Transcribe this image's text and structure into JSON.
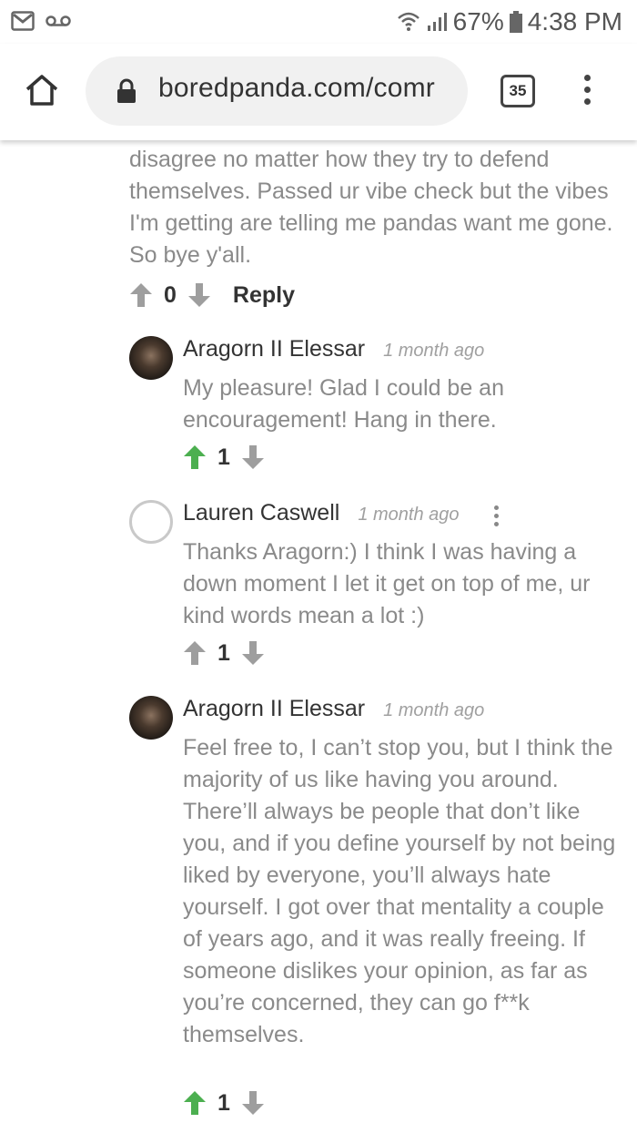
{
  "status": {
    "battery": "67%",
    "time": "4:38 PM"
  },
  "browser": {
    "url": "boredpanda.com/comr",
    "tab_count": "35"
  },
  "top_comment": {
    "text": "disagree no matter how they try to defend themselves. Passed ur vibe check but the vibes I'm getting are telling me pandas want me gone. So bye y'all.",
    "votes": "0",
    "reply_label": "Reply"
  },
  "replies": [
    {
      "author": "Aragorn II Elessar",
      "time": "1 month ago",
      "text": "My pleasure! Glad I could be an encouragement! Hang in there.",
      "votes": "1",
      "upvoted": true
    },
    {
      "author": "Lauren Caswell",
      "time": "1 month ago",
      "text": "Thanks Aragorn:) I think I was having a down moment I let it get on top of me, ur kind words mean a lot :)",
      "votes": "1",
      "upvoted": false
    },
    {
      "author": "Aragorn II Elessar",
      "time": "1 month ago",
      "text": "Feel free to, I can’t stop you, but I think the majority of us like having you around. There’ll always be people that don’t like you, and if you define yourself by not being liked by everyone, you’ll always hate yourself. I got over that mentality a couple of years ago, and it was really freeing. If someone dislikes your opinion, as far as you’re concerned, they can go f**k themselves.",
      "votes": "1",
      "upvoted": true
    }
  ],
  "colors": {
    "upvote_active": "#4caf50",
    "vote_inactive": "#9e9e9e"
  }
}
